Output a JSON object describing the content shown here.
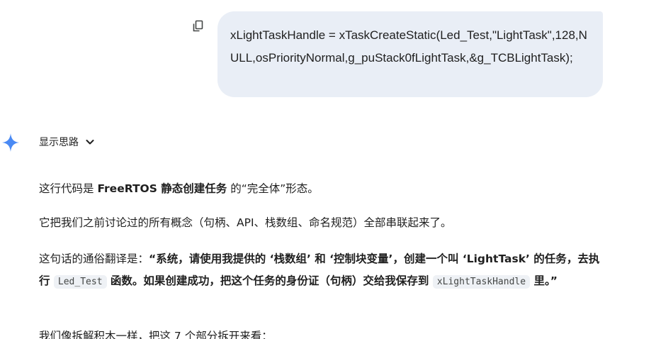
{
  "user_prompt": {
    "text": "xLightTaskHandle = xTaskCreateStatic(Led_Test,\"LightTask\",128,NULL,osPriorityNormal,g_puStack0fLightTask,&g_TCBLightTask);"
  },
  "icons": {
    "copy": "copy-icon",
    "assistant": "gemini-spark-icon",
    "toggle": "chevron-down-icon"
  },
  "response": {
    "thoughts_label": "显示思路",
    "p1": {
      "a": "这行代码是 ",
      "b": "FreeRTOS 静态创建任务",
      "c": " 的“完全体”形态。"
    },
    "p2": "它把我们之前讨论过的所有概念（句柄、API、栈数组、命名规范）全部串联起来了。",
    "p3": {
      "a": "这句话的通俗翻译是：",
      "b": "“系统，请使用我提供的 ‘栈数组’ 和 ‘控制块变量’，创建一个叫 ‘LightTask’ 的任务，去执行 ",
      "code1": "Led_Test",
      "c": " 函数。如果创建成功，把这个任务的身份证（句柄）交给我保存到 ",
      "code2": "xLightTaskHandle",
      "d": " 里。”"
    },
    "p4": "我们像拆解积木一样，把这 7 个部分拆开来看："
  },
  "colors": {
    "bubble_bg": "#e9eef6",
    "spark_blue": "#4a8af4",
    "code_bg": "#eef1f5"
  }
}
